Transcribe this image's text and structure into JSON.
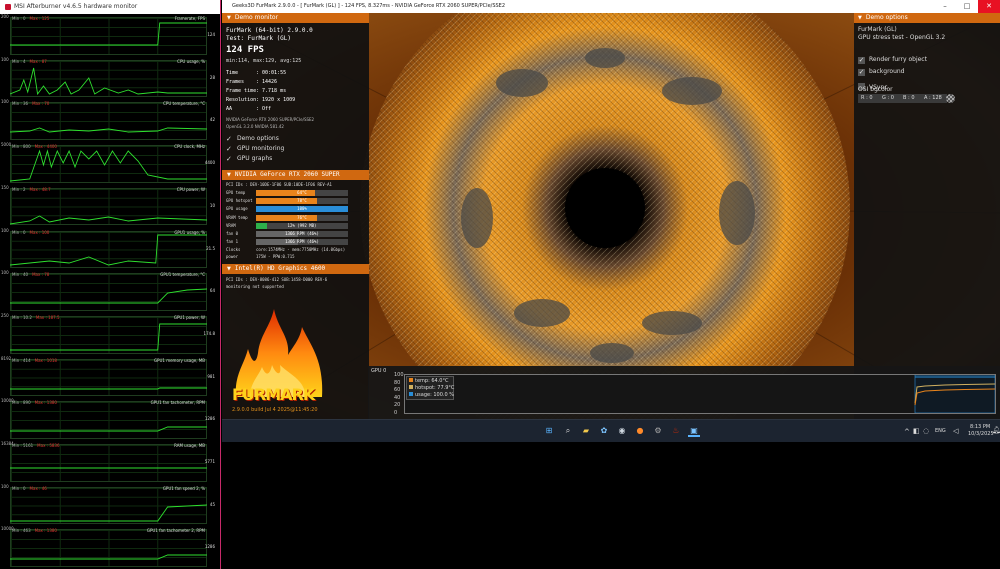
{
  "afterburner": {
    "title": "MSI Afterburner v4.6.5 hardware monitor",
    "graphs": [
      {
        "name": "Framerate, FPS",
        "min_label": "Min : 0",
        "max_label": "Max : 125",
        "scale_top": "200",
        "current": "124"
      },
      {
        "name": "CPU usage, %",
        "min_label": "Min : 4",
        "max_label": "Max : 87",
        "scale_top": "100",
        "current": "28"
      },
      {
        "name": "CPU temperature, °C",
        "min_label": "Min : 36",
        "max_label": "Max : 70",
        "scale_top": "100",
        "current": "42"
      },
      {
        "name": "CPU clock, MHz",
        "min_label": "Min : 800",
        "max_label": "Max : 4400",
        "scale_top": "5000",
        "current": "4400"
      },
      {
        "name": "CPU power, W",
        "min_label": "Min : 2",
        "max_label": "Max : 48.7",
        "scale_top": "150",
        "current": "10"
      },
      {
        "name": "GPU1 usage, %",
        "min_label": "Min : 0",
        "max_label": "Max : 100",
        "scale_top": "100",
        "current": "21.5"
      },
      {
        "name": "GPU1 temperature, °C",
        "min_label": "Min : 40",
        "max_label": "Max : 78",
        "scale_top": "100",
        "current": "64"
      },
      {
        "name": "GPU1 power, W",
        "min_label": "Min : 10.2",
        "max_label": "Max : 187.5",
        "scale_top": "250",
        "current": "174.8"
      },
      {
        "name": "GPU1 memory usage, MB",
        "min_label": "Min : 414",
        "max_label": "Max : 1018",
        "scale_top": "8192",
        "current": "981"
      },
      {
        "name": "GPU1 fan tachometer, RPM",
        "min_label": "Min : 890",
        "max_label": "Max : 1380",
        "scale_top": "10000",
        "current": "1286"
      },
      {
        "name": "RAM usage, MB",
        "min_label": "Min : 5161",
        "max_label": "Max : 5836",
        "scale_top": "16384",
        "current": "5771"
      },
      {
        "name": "GPU1 fan speed 2, %",
        "min_label": "Min : 0",
        "max_label": "Max : 46",
        "scale_top": "100",
        "current": "45"
      },
      {
        "name": "GPU1 fan tachometer 2, RPM",
        "min_label": "Min : 463",
        "max_label": "Max : 1380",
        "scale_top": "10000",
        "current": "1286"
      }
    ]
  },
  "furmark": {
    "window_title": "Geeks3D FurMark 2.9.0.0 - [ FurMark (GL) ] - 124 FPS, 8.327ms - NVIDIA GeForce RTX 2060 SUPER/PCIe/SSE2",
    "demo_monitor": {
      "header": "Demo monitor",
      "app": "FurMark (64-bit) 2.9.0.0",
      "test": "Test: FurMark (GL)",
      "fps": "124 FPS",
      "minmax": "min:114, max:129, avg:125",
      "stats": [
        {
          "k": "Time",
          "v": ": 00:01:55"
        },
        {
          "k": "Frames",
          "v": ": 14426"
        },
        {
          "k": "Frame time",
          "v": ": 7.718 ms"
        },
        {
          "k": "Resolution",
          "v": ": 1920 x 1009"
        },
        {
          "k": "AA",
          "v": ": Off"
        }
      ],
      "renderer": "NVIDIA GeForce RTX 2060 SUPER/PCIe/SSE2",
      "gl": "OpenGL 3.2.0 NVIDIA 581.42",
      "checks": [
        "Demo options",
        "GPU monitoring",
        "GPU graphs"
      ]
    },
    "gpu0": {
      "header": "NVIDIA GeForce RTX 2060 SUPER",
      "pci": "PCI IDs : DEV-10DE-1F06 SUB:10DE-1F06 REV-A1",
      "rows": [
        {
          "label": "GPU temp",
          "value": "64°C",
          "fill": 0.64,
          "color": "#e8841c"
        },
        {
          "label": "GPU hotspot",
          "value": "78°C",
          "fill": 0.66,
          "color": "#e8841c"
        },
        {
          "label": "GPU usage",
          "value": "100%",
          "fill": 1.0,
          "color": "#2a8ed8"
        },
        {
          "label": "VRAM temp",
          "value": "76°C",
          "fill": 0.66,
          "color": "#e8841c"
        },
        {
          "label": "VRAM",
          "value": "12% (992 MB)",
          "fill": 0.12,
          "color": "#2db04b"
        },
        {
          "label": "fan 0",
          "value": "1366 RPM (46%)",
          "fill": 0.46,
          "color": "#666"
        },
        {
          "label": "fan 1",
          "value": "1366 RPM (46%)",
          "fill": 0.46,
          "color": "#666"
        }
      ],
      "clocks_label": "Clocks",
      "clocks": "core:1574MHz - mem:7750MHz (14.0Gbps)",
      "power_label": "power",
      "power": "175W - PPW:0.715"
    },
    "gpu1": {
      "header": "Intel(R) HD Graphics 4600",
      "pci": "PCI IDs : DEV-8086-412 SUB:1458-D000 REV-6",
      "note": "monitoring not supported"
    },
    "logo_text": "FURMARK",
    "build": "2.9.0.0 build Jul 4 2025@11:45:20",
    "demo_options": {
      "header": "Demo options",
      "title": "FurMark (GL)",
      "subtitle": "GPU stress test - OpenGL 3.2",
      "checks": [
        {
          "label": "Render furry object",
          "checked": true
        },
        {
          "label": "background",
          "checked": true
        },
        {
          "label": "VSync",
          "checked": false
        }
      ],
      "osi_label": "OSI bgcolor",
      "rgba": [
        {
          "k": "R",
          "v": "0"
        },
        {
          "k": "G",
          "v": "0"
        },
        {
          "k": "B",
          "v": "0"
        },
        {
          "k": "A",
          "v": "128"
        }
      ]
    },
    "gpu_graph": {
      "title": "GPU 0",
      "y_labels": [
        "100",
        "80",
        "60",
        "40",
        "20",
        "0"
      ],
      "legend": [
        {
          "label": "temp: 64.0°C",
          "color": "#e8841c"
        },
        {
          "label": "hotspot: 77.9°C",
          "color": "#d0b060"
        },
        {
          "label": "usage: 100.0 %",
          "color": "#2a8ed8"
        }
      ]
    }
  },
  "taskbar": {
    "lang": "ENG",
    "time": "8:13 PM",
    "date": "10/3/2025"
  }
}
